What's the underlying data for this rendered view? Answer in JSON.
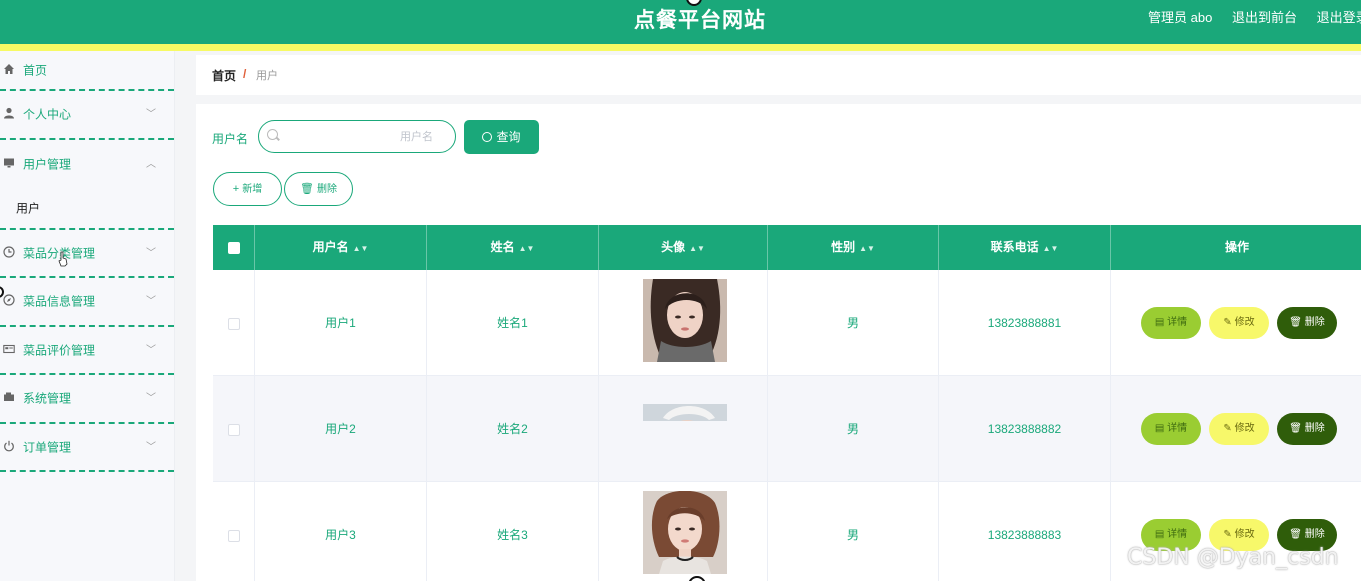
{
  "header": {
    "site_title": "点餐平台网站",
    "user_label": "管理员 abo",
    "links": [
      "退出到前台",
      "退出登录"
    ]
  },
  "sidebar": {
    "items": [
      {
        "label": "首页",
        "icon": "home-icon",
        "arrow": false
      },
      {
        "label": "个人中心",
        "icon": "user-icon",
        "arrow": "down"
      },
      {
        "label": "用户管理",
        "icon": "monitor-icon",
        "arrow": "up"
      },
      {
        "label": "菜品分类管理",
        "icon": "clock-icon",
        "arrow": "down"
      },
      {
        "label": "菜品信息管理",
        "icon": "compass-icon",
        "arrow": "down"
      },
      {
        "label": "菜品评价管理",
        "icon": "card-icon",
        "arrow": "down"
      },
      {
        "label": "系统管理",
        "icon": "wallet-icon",
        "arrow": "down"
      },
      {
        "label": "订单管理",
        "icon": "power-icon",
        "arrow": "down"
      }
    ],
    "sub_items": [
      "用户"
    ]
  },
  "breadcrumb": {
    "home": "首页",
    "separator": "/",
    "current": "用户"
  },
  "search": {
    "label": "用户名",
    "placeholder": "用户名",
    "value": "",
    "query_button": "查询"
  },
  "actions": {
    "add": "新增",
    "delete": "删除"
  },
  "table": {
    "columns": [
      "用户名",
      "姓名",
      "头像",
      "性别",
      "联系电话",
      "操作"
    ],
    "rows": [
      {
        "username": "用户1",
        "name": "姓名1",
        "gender": "男",
        "phone": "13823888881"
      },
      {
        "username": "用户2",
        "name": "姓名2",
        "gender": "男",
        "phone": "13823888882"
      },
      {
        "username": "用户3",
        "name": "姓名3",
        "gender": "男",
        "phone": "13823888883"
      }
    ],
    "row_actions": {
      "detail": "详情",
      "edit": "修改",
      "delete": "删除"
    }
  },
  "watermark": "CSDN @Dyan_csdn",
  "colors": {
    "primary": "#1aa87a",
    "accent_yellow": "#f7fa64",
    "detail": "#9acd32",
    "edit": "#f7f86a",
    "delete": "#2f5d0a"
  }
}
